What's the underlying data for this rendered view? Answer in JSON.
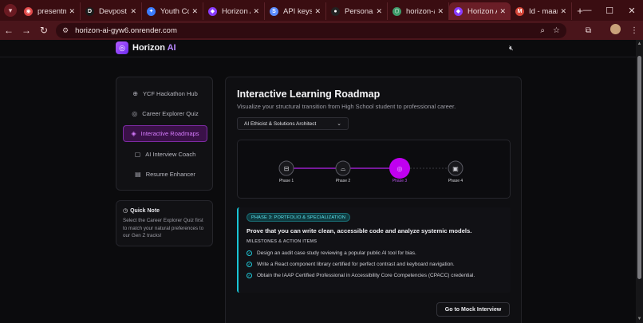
{
  "browser": {
    "tabs": [
      {
        "title": "presentmi",
        "fav_color": "#e04a4a",
        "fav_glyph": "◉"
      },
      {
        "title": "Devpost",
        "fav_color": "#1b1b1b",
        "fav_glyph": "D"
      },
      {
        "title": "Youth Cod",
        "fav_color": "#3b7cff",
        "fav_glyph": "✦"
      },
      {
        "title": "Horizon A",
        "fav_color": "#8a3cff",
        "fav_glyph": "◆"
      },
      {
        "title": "API keys |",
        "fav_color": "#5b8cff",
        "fav_glyph": "S"
      },
      {
        "title": "Personal /",
        "fav_color": "#222",
        "fav_glyph": "●"
      },
      {
        "title": "horizon-ai",
        "fav_color": "#3e9b6a",
        "fav_glyph": "⬡"
      },
      {
        "title": "Horizon A",
        "fav_color": "#8a3cff",
        "fav_glyph": "◆"
      },
      {
        "title": "Id - maan",
        "fav_color": "#d44638",
        "fav_glyph": "M"
      }
    ],
    "url": "horizon-ai-gyw6.onrender.com"
  },
  "header": {
    "brand_name": "Horizon",
    "brand_accent": "AI"
  },
  "sidebar": {
    "items": [
      {
        "label": "YCF Hackathon Hub",
        "icon": "globe-icon"
      },
      {
        "label": "Career Explorer Quiz",
        "icon": "compass-icon"
      },
      {
        "label": "Interactive Roadmaps",
        "icon": "layers-icon"
      },
      {
        "label": "AI Interview Coach",
        "icon": "chat-icon"
      },
      {
        "label": "Resume Enhancer",
        "icon": "document-icon"
      }
    ],
    "active_index": 2
  },
  "note": {
    "title": "Quick Note",
    "text": "Select the Career Explorer Quiz first to match your natural preferences to our Gen Z tracks!"
  },
  "main": {
    "title": "Interactive Learning Roadmap",
    "subtitle": "Visualize your structural transition from High School student to professional career.",
    "selected_track": "AI Ethicist & Solutions Architect",
    "phases": [
      {
        "label": "Phase 1",
        "icon": "book-icon"
      },
      {
        "label": "Phase 2",
        "icon": "graduation-cap-icon"
      },
      {
        "label": "Phase 3",
        "icon": "target-icon"
      },
      {
        "label": "Phase 4",
        "icon": "briefcase-icon"
      }
    ],
    "active_phase": 3,
    "detail": {
      "badge": "PHASE 3: PORTFOLIO & SPECIALIZATION",
      "heading": "Prove that you can write clean, accessible code and analyze systemic models.",
      "milestones_label": "MILESTONES & ACTION ITEMS",
      "milestones": [
        "Design an audit case study reviewing a popular public AI tool for bias.",
        "Write a React component library certified for perfect contrast and keyboard navigation.",
        "Obtain the IAAP Certified Professional in Accessibility Core Competencies (CPACC) credential."
      ]
    },
    "cta_label": "Go to Mock Interview"
  },
  "colors": {
    "accent_purple": "#c000f0",
    "accent_cyan": "#19c3d4",
    "chrome_red": "#4a151b"
  }
}
